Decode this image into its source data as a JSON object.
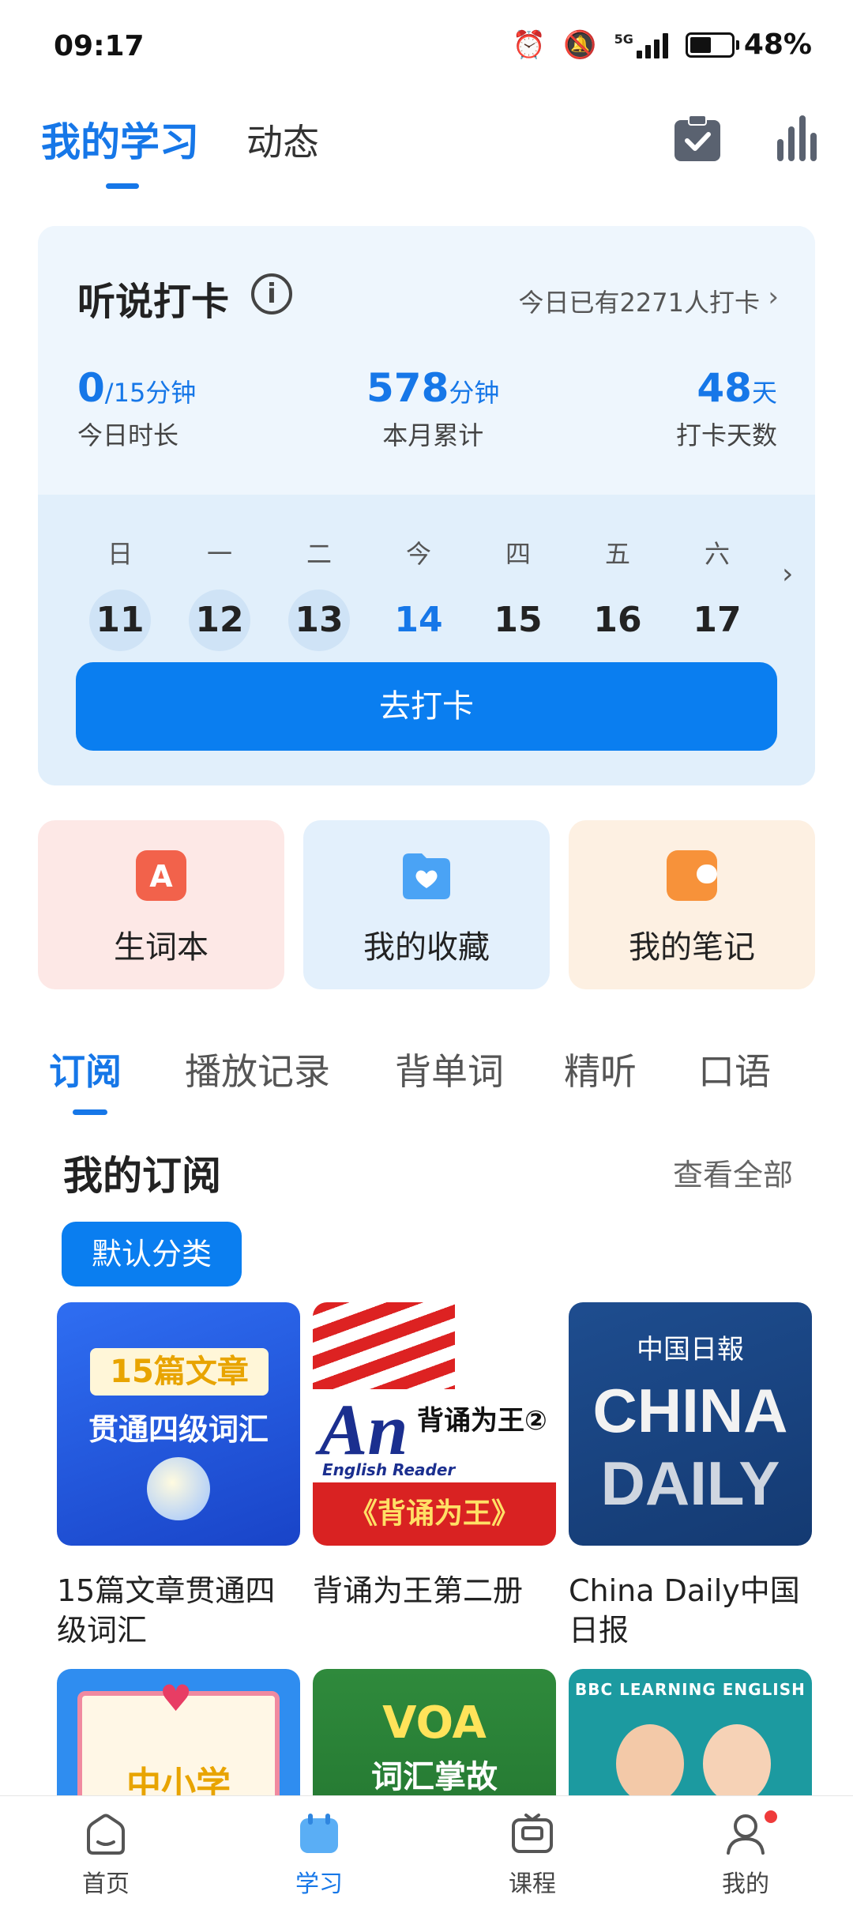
{
  "status_bar": {
    "time": "09:17",
    "battery": "48%",
    "network": "5G"
  },
  "header": {
    "tab_active": "我的学习",
    "tab_other": "动态"
  },
  "checkin_card": {
    "title": "听说打卡",
    "summary_link": "今日已有2271人打卡",
    "stats": [
      {
        "value": "0",
        "unit": "/15分钟",
        "label": "今日时长"
      },
      {
        "value": "578",
        "unit": "分钟",
        "label": "本月累计"
      },
      {
        "value": "48",
        "unit": "天",
        "label": "打卡天数"
      }
    ],
    "weekdays": [
      "日",
      "一",
      "二",
      "今",
      "四",
      "五",
      "六"
    ],
    "dates": [
      "11",
      "12",
      "13",
      "14",
      "15",
      "16",
      "17"
    ],
    "button": "去打卡"
  },
  "quick_tiles": [
    "生词本",
    "我的收藏",
    "我的笔记"
  ],
  "sub_tabs": [
    "订阅",
    "播放记录",
    "背单词",
    "精听",
    "口语"
  ],
  "subscriptions": {
    "title": "我的订阅",
    "view_all": "查看全部",
    "category_chip": "默认分类",
    "courses": [
      {
        "title": "15篇文章贯通四级词汇",
        "cover_line1": "15篇文章",
        "cover_line2": "贯通四级词汇"
      },
      {
        "title": "背诵为王第二册",
        "cover_an": "An",
        "cover_sub": "背诵为王②",
        "cover_er": "English Reader",
        "cover_band": "《背诵为王》"
      },
      {
        "title": "China Daily中国日报",
        "cover_cn": "中国日報",
        "cover_w1": "CHINA",
        "cover_w2": "DAILY"
      },
      {
        "title": "",
        "cover_text": "中小学"
      },
      {
        "title": "",
        "cover_voa": "VOA",
        "cover_text": "词汇掌故"
      },
      {
        "title": "",
        "cover_text": "BBC LEARNING ENGLISH"
      }
    ]
  },
  "bottom_nav": [
    "首页",
    "学习",
    "课程",
    "我的"
  ]
}
